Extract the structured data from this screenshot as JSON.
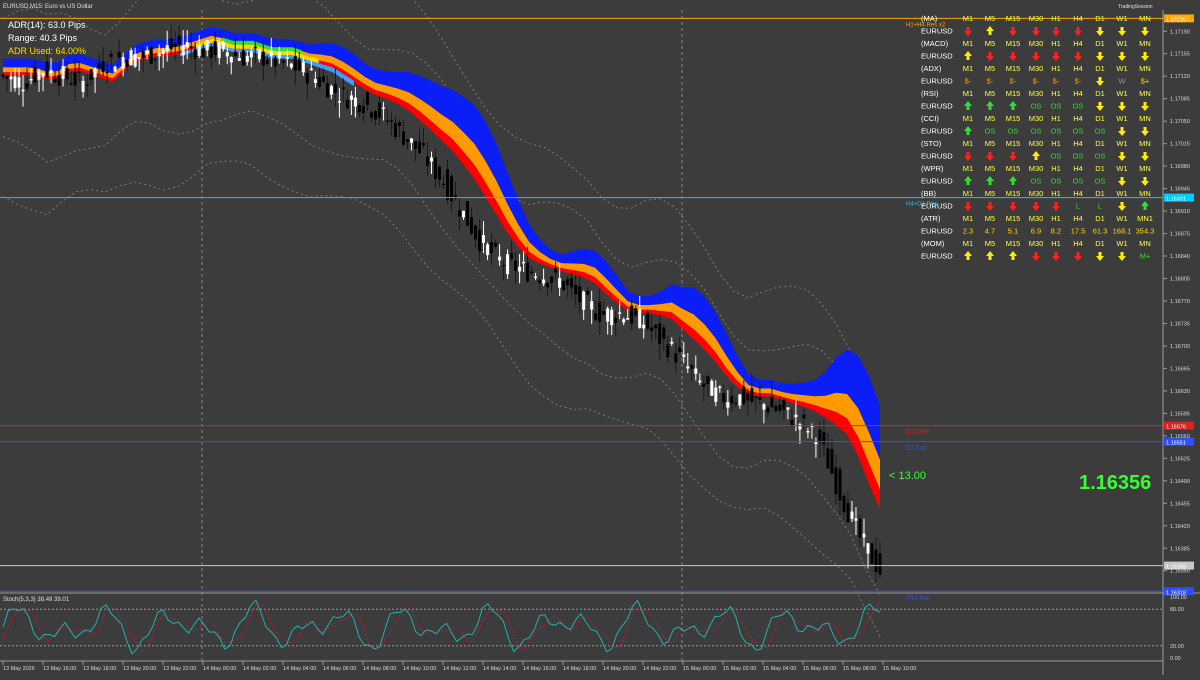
{
  "window": {
    "title": "EURUSD,M15:  Euro vs US Dollar",
    "top_right_label": "TradingSession"
  },
  "info_panel": {
    "adr": "ADR(14): 63.0 Pips",
    "range": "Range: 40.3 Pips",
    "adr_used": "ADR Used: 64.00%"
  },
  "price_label": "1.16356",
  "arrow_label": "< 13.00",
  "colors": {
    "background": "#3c3c3c",
    "bull_candle": "#ffffff",
    "bear_candle": "#000000",
    "ribbon_blue": "#0a1ef5",
    "ribbon_orange": "#ff9900",
    "ribbon_red": "#ff0000",
    "ribbon_green": "#33dd33",
    "ribbon_yellow": "#ffd800",
    "ribbon_lightblue": "#3aa0ff",
    "up_arrow": "#ffee00",
    "down_arrow": "#ff2020",
    "green_arrow": "#33dd33",
    "table_header": "#ffff44",
    "table_name": "#ffffff",
    "stoch_main": "#20b2aa",
    "stoch_signal": "#dc143c",
    "price_text": "#33ff33",
    "pivot_label": "#ffa500"
  },
  "levels": [
    {
      "name": "H1+H4 Res x2",
      "price": 1.1721,
      "color": "#ffa500"
    },
    {
      "name": "H4+D1 Res",
      "price": 1.16931,
      "color": "#00ccff"
    },
    {
      "name": "M15 Res",
      "price": 1.16576,
      "color": "#dd2222"
    },
    {
      "name": "D1 Sup",
      "price": 1.16551,
      "color": "#3050ff"
    },
    {
      "name": "",
      "price": 1.16358,
      "color": "#c8c8c8"
    },
    {
      "name": "M15 Sup",
      "price": 1.16318,
      "color": "#3050ff"
    }
  ],
  "signal_table": {
    "columns": [
      "M1",
      "M5",
      "M15",
      "M30",
      "H1",
      "H4",
      "D1",
      "W1",
      "MN"
    ],
    "rows": [
      {
        "indicator": "(MA)",
        "symbol": "EURUSD",
        "cells": [
          "down",
          "up",
          "down",
          "down",
          "down",
          "down",
          "down",
          "down",
          "down"
        ]
      },
      {
        "indicator": "(MACD)",
        "symbol": "EURUSD",
        "cells": [
          "up",
          "down",
          "down",
          "down",
          "down",
          "down",
          "down",
          "down",
          "down"
        ]
      },
      {
        "indicator": "(ADX)",
        "symbol": "EURUSD",
        "cells": [
          "$-",
          "$-",
          "$-",
          "$-",
          "$-",
          "$-",
          "down",
          "W",
          "$+"
        ]
      },
      {
        "indicator": "(RSI)",
        "symbol": "EURUSD",
        "cells": [
          "up",
          "up",
          "up",
          "OS",
          "OS",
          "OS",
          "down",
          "down",
          "down"
        ]
      },
      {
        "indicator": "(CCI)",
        "symbol": "EURUSD",
        "cells": [
          "up",
          "OS",
          "OS",
          "OS",
          "OS",
          "OS",
          "OS",
          "down",
          "down"
        ]
      },
      {
        "indicator": "(STO)",
        "symbol": "EURUSD",
        "cells": [
          "down",
          "down",
          "down",
          "up",
          "OS",
          "OS",
          "OS",
          "down",
          "down"
        ]
      },
      {
        "indicator": "(WPR)",
        "symbol": "EURUSD",
        "cells": [
          "up",
          "up",
          "up",
          "OS",
          "OS",
          "OS",
          "OS",
          "down",
          "down"
        ]
      },
      {
        "indicator": "(BB)",
        "symbol": "EURUSD",
        "cells": [
          "down",
          "down",
          "down",
          "down",
          "down",
          "L",
          "L",
          "down",
          "up"
        ]
      },
      {
        "indicator": "(ATR)",
        "symbol": "EURUSD",
        "columns_override": [
          "M1",
          "M5",
          "M15",
          "M30",
          "H1",
          "H4",
          "D1",
          "W1",
          "MN1"
        ],
        "cells": [
          "2.3",
          "4.7",
          "5.1",
          "6.9",
          "8.2",
          "17.5",
          "61.3",
          "168.1",
          "354.3"
        ]
      },
      {
        "indicator": "(MOM)",
        "symbol": "EURUSD",
        "cells": [
          "up",
          "up",
          "up",
          "down",
          "down",
          "down",
          "down",
          "down",
          "M+"
        ]
      }
    ]
  },
  "stoch": {
    "label": "Stoch(5,3,3) 38.49 39.01",
    "levels": [
      80,
      20
    ],
    "ticks": [
      "100.00",
      "80.00",
      "20.00",
      "0.00"
    ]
  },
  "chart_data": {
    "type": "candlestick",
    "symbol": "EURUSD",
    "timeframe": "M15",
    "y_ticks": [
      1.1721,
      1.1719,
      1.17155,
      1.1712,
      1.17085,
      1.1705,
      1.17015,
      1.1698,
      1.16945,
      1.1691,
      1.16875,
      1.1684,
      1.16805,
      1.1677,
      1.16735,
      1.167,
      1.16665,
      1.1663,
      1.16595,
      1.1656,
      1.16525,
      1.1649,
      1.16455,
      1.1642,
      1.16385,
      1.1635,
      1.16315
    ],
    "ylim": [
      1.1632,
      1.1722
    ],
    "x_labels": [
      "13 May 2026",
      "13 May 16:00",
      "13 May 18:00",
      "13 May 20:00",
      "13 May 22:00",
      "14 May 00:00",
      "14 May 02:00",
      "14 May 04:00",
      "14 May 06:00",
      "14 May 08:00",
      "14 May 10:00",
      "14 May 12:00",
      "14 May 14:00",
      "14 May 16:00",
      "14 May 18:00",
      "14 May 20:00",
      "14 May 22:00",
      "15 May 00:00",
      "15 May 02:00",
      "15 May 04:00",
      "15 May 06:00",
      "15 May 08:00",
      "15 May 10:00"
    ],
    "close_path": [
      1.1712,
      1.1711,
      1.1713,
      1.1712,
      1.1711,
      1.1714,
      1.1715,
      1.1715,
      1.1716,
      1.1717,
      1.1716,
      1.1716,
      1.1715,
      1.1715,
      1.1714,
      1.1713,
      1.1711,
      1.1709,
      1.1708,
      1.1706,
      1.1703,
      1.17,
      1.1696,
      1.1691,
      1.1686,
      1.1683,
      1.1682,
      1.1681,
      1.168,
      1.1677,
      1.1675,
      1.1675,
      1.1674,
      1.1671,
      1.1668,
      1.1664,
      1.1662,
      1.1662,
      1.1661,
      1.166,
      1.1658,
      1.1655,
      1.1647,
      1.164,
      1.1635
    ],
    "series": [
      {
        "name": "Price",
        "role": "candles"
      },
      {
        "name": "Ribbon",
        "role": "moving-average-band"
      },
      {
        "name": "Envelope",
        "role": "dotted-bands"
      }
    ],
    "grid": false
  }
}
